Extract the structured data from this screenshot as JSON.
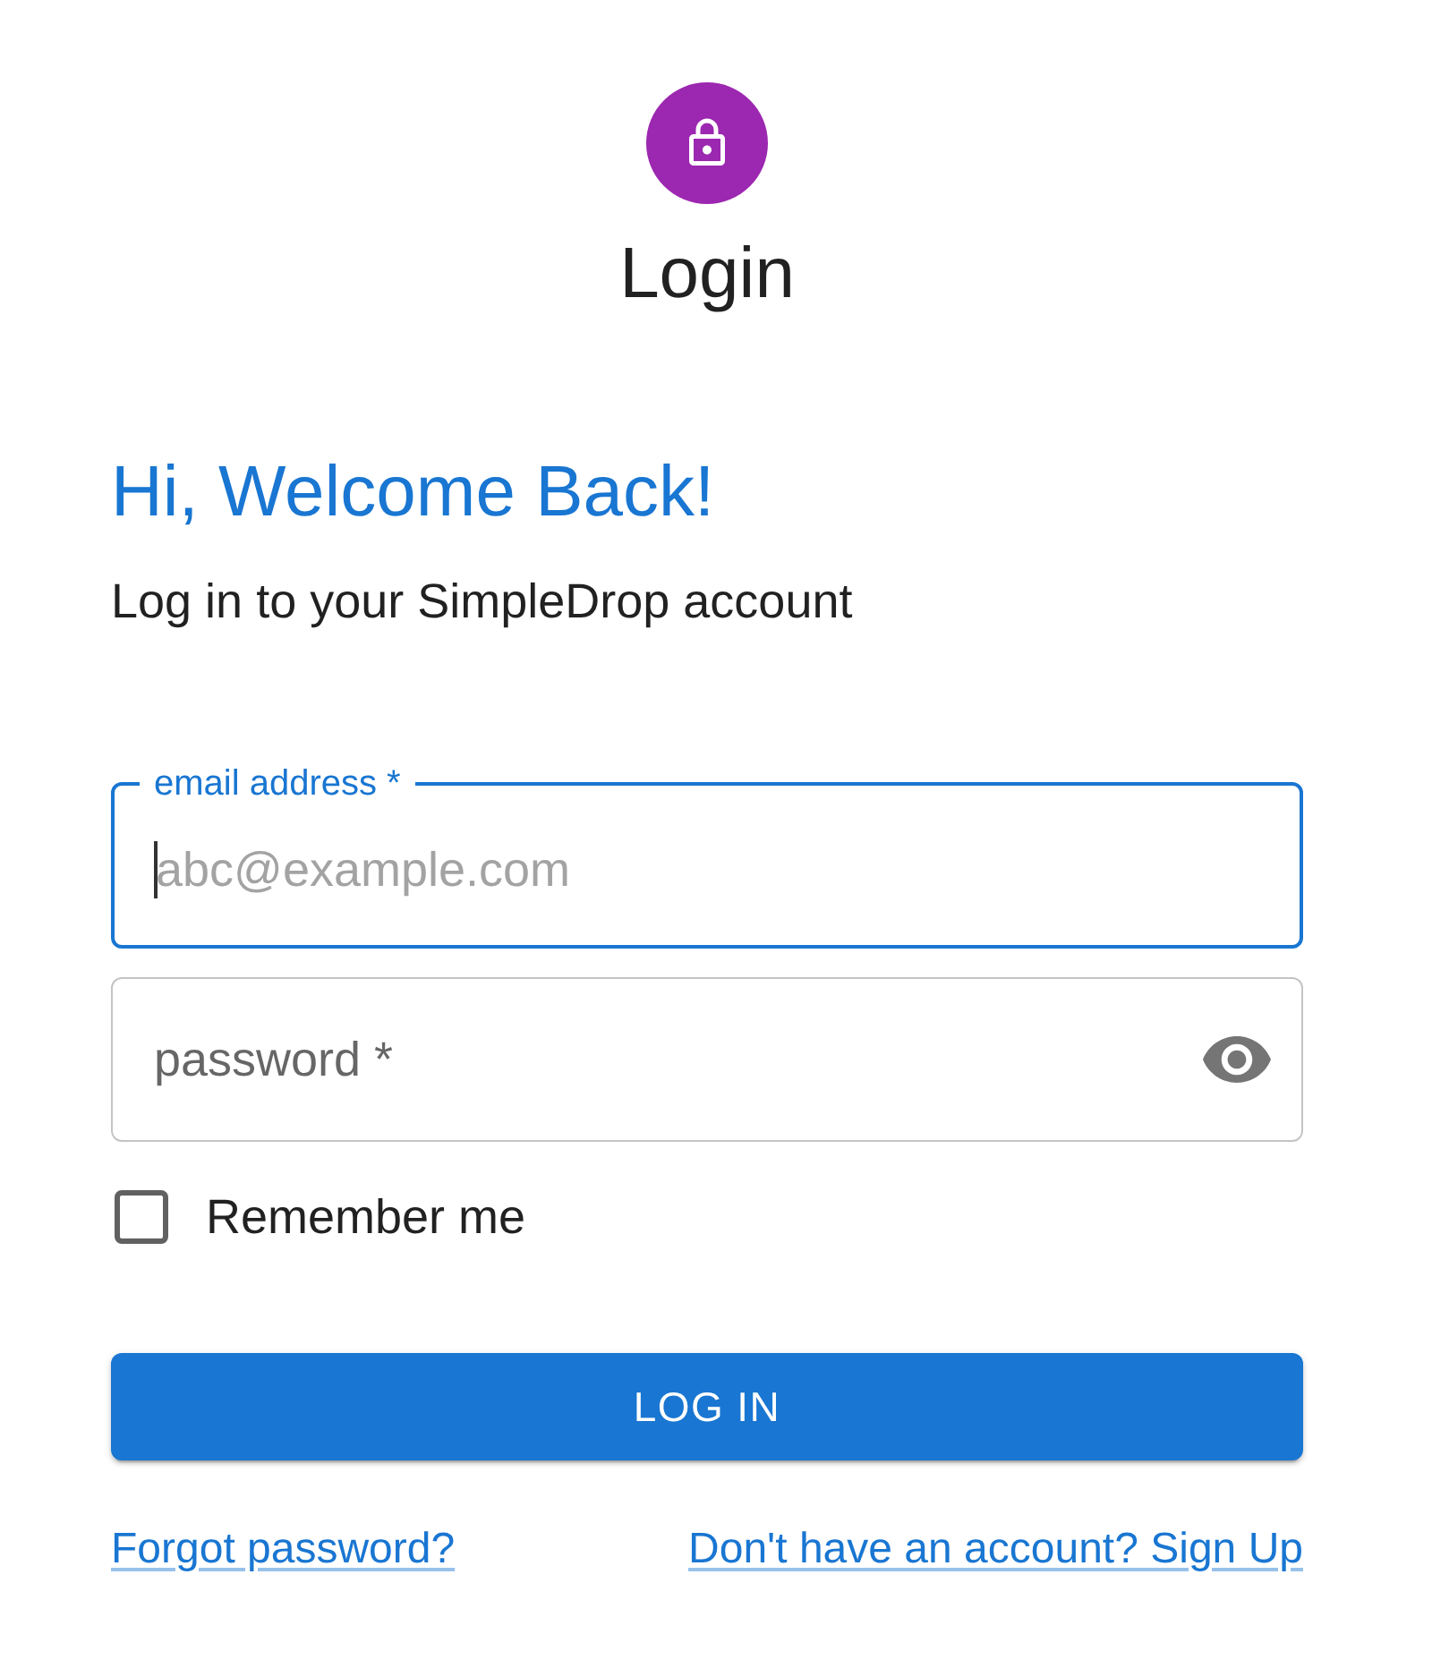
{
  "header": {
    "title": "Login"
  },
  "greeting": {
    "heading": "Hi, Welcome Back!",
    "subtitle": "Log in to your SimpleDrop account"
  },
  "fields": [
    {
      "kind": "email",
      "label": "email address *",
      "placeholder": "abc@example.com",
      "focused": true
    },
    {
      "kind": "password",
      "label": "password *",
      "focused": false
    }
  ],
  "remember": {
    "label": "Remember me",
    "checked": false
  },
  "submit": {
    "label": "LOG IN"
  },
  "links": [
    {
      "label": "Forgot password?"
    },
    {
      "label": "Don't have an account? Sign Up"
    }
  ]
}
